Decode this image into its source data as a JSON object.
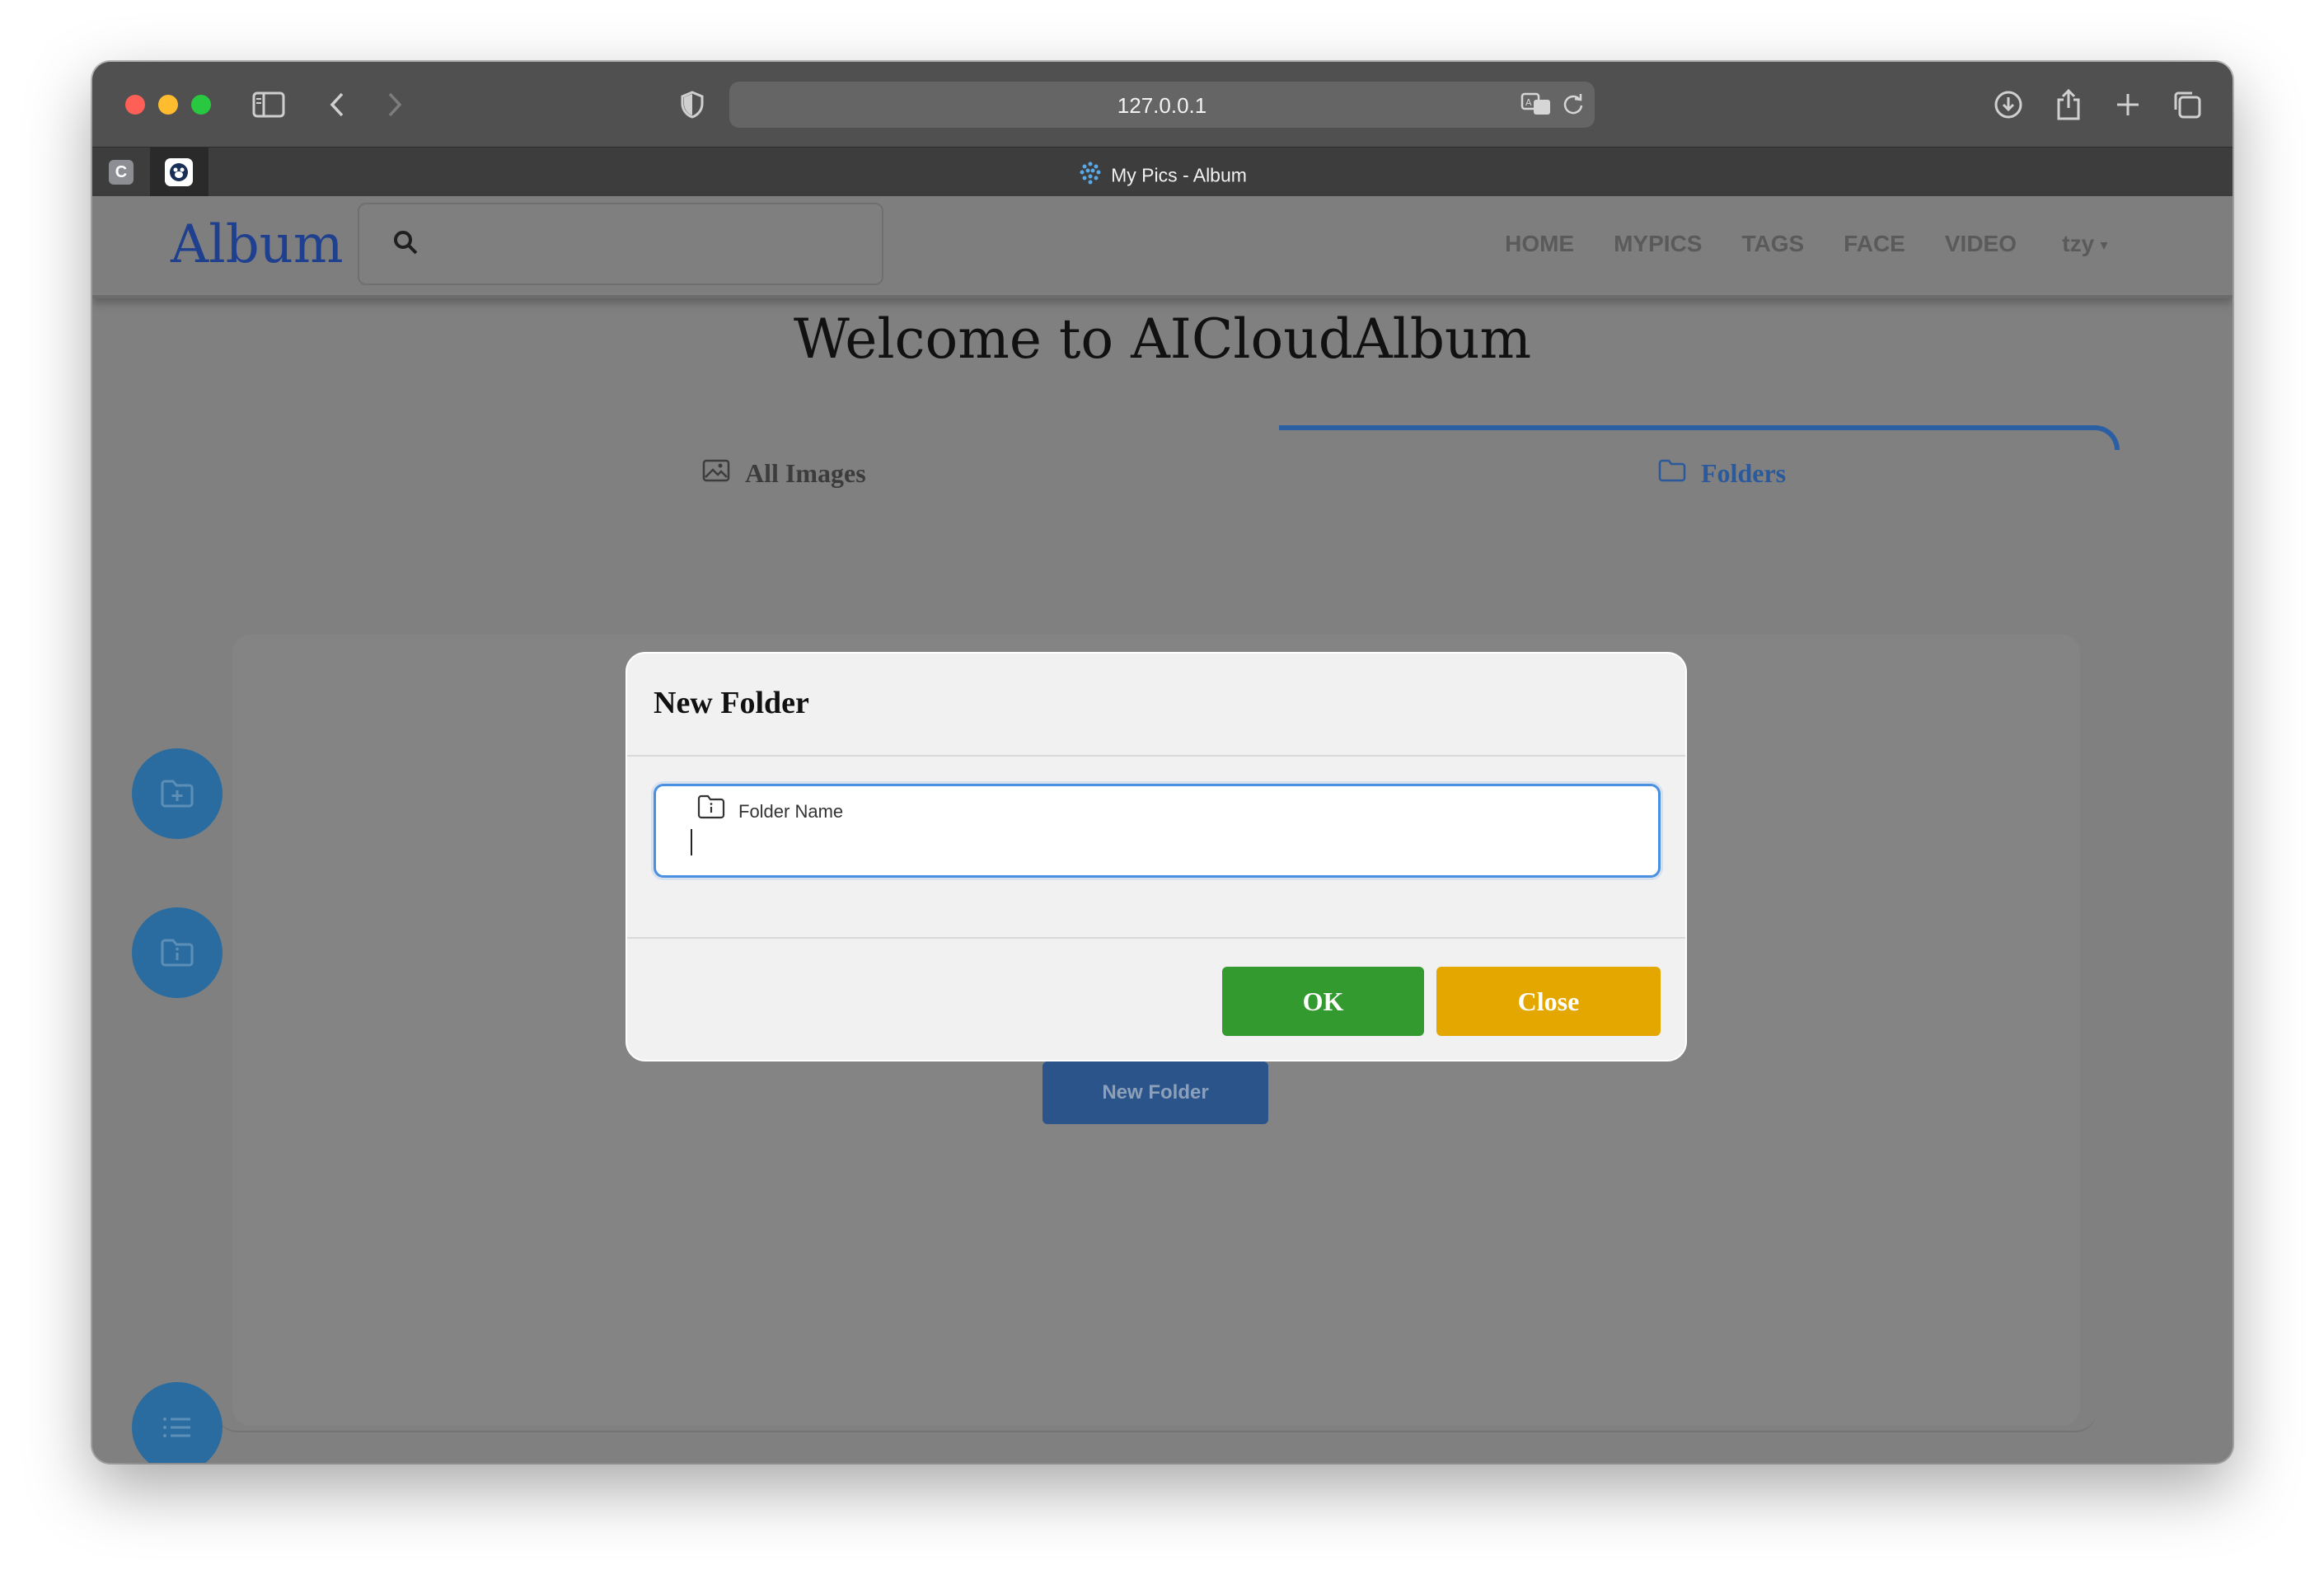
{
  "browser": {
    "url": "127.0.0.1",
    "tab_title": "My Pics - Album",
    "pinned_tabs": [
      "C",
      "bear"
    ]
  },
  "navbar": {
    "brand": "Album",
    "search_placeholder": "",
    "links": [
      "HOME",
      "MYPICS",
      "TAGS",
      "FACE",
      "VIDEO"
    ],
    "user": "tzy"
  },
  "page": {
    "welcome": "Welcome to AICloudAlbum",
    "tabs": {
      "all_images": "All Images",
      "folders": "Folders"
    },
    "new_folder_button": "New Folder"
  },
  "modal": {
    "title": "New Folder",
    "input_label": "Folder Name",
    "input_value": "",
    "ok_label": "OK",
    "close_label": "Close"
  },
  "colors": {
    "accent_blue": "#2b5fa4",
    "ok_green": "#339a2f",
    "close_yellow": "#e3a700",
    "fab_blue": "#2a6c9f"
  }
}
